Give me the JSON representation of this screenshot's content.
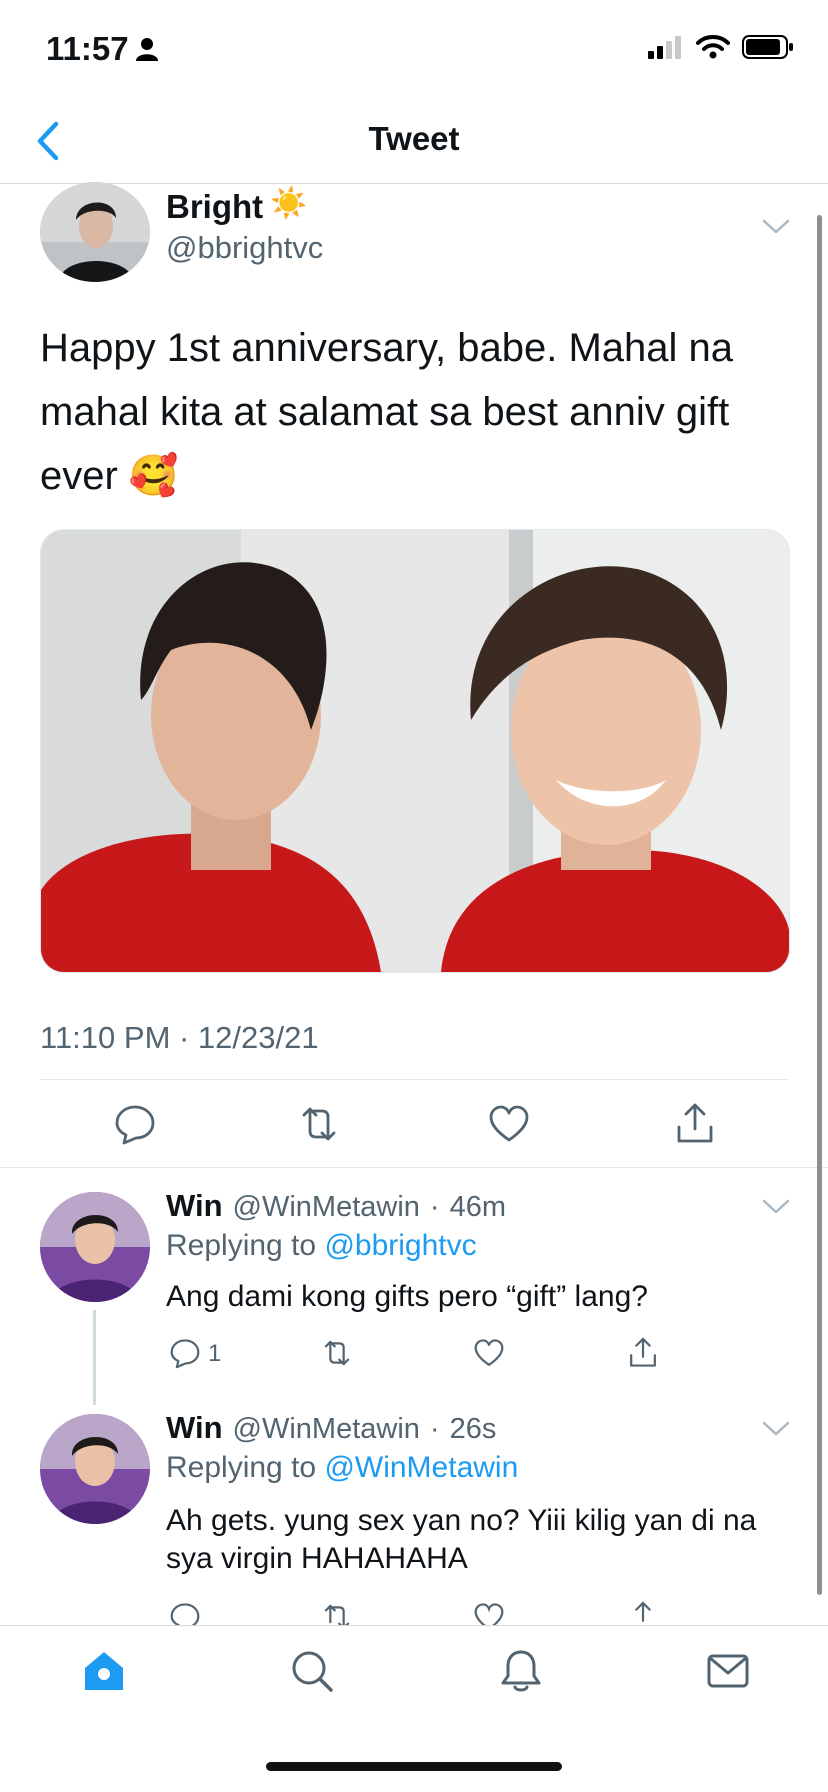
{
  "status_bar": {
    "time": "11:57"
  },
  "nav": {
    "title": "Tweet"
  },
  "tweet": {
    "author_name": "Bright",
    "author_emoji": "☀️",
    "author_handle": "@bbrightvc",
    "text": "Happy 1st anniversary, babe. Mahal na mahal kita at salamat sa best anniv gift ever 🥰",
    "timestamp": "11:10 PM · 12/23/21"
  },
  "replies": [
    {
      "name": "Win",
      "handle": "@WinMetawin",
      "age": "46m",
      "replying_prefix": "Replying to ",
      "replying_to": "@bbrightvc",
      "text": "Ang dami kong gifts pero “gift” lang?",
      "reply_count": "1"
    },
    {
      "name": "Win",
      "handle": "@WinMetawin",
      "age": "26s",
      "replying_prefix": "Replying to ",
      "replying_to": "@WinMetawin",
      "text": "Ah gets. yung sex yan no? Yiii kilig yan di na sya virgin HAHAHAHA"
    }
  ],
  "colors": {
    "accent": "#1d9bf0",
    "secondary_text": "#536471",
    "icon": "#536471"
  }
}
